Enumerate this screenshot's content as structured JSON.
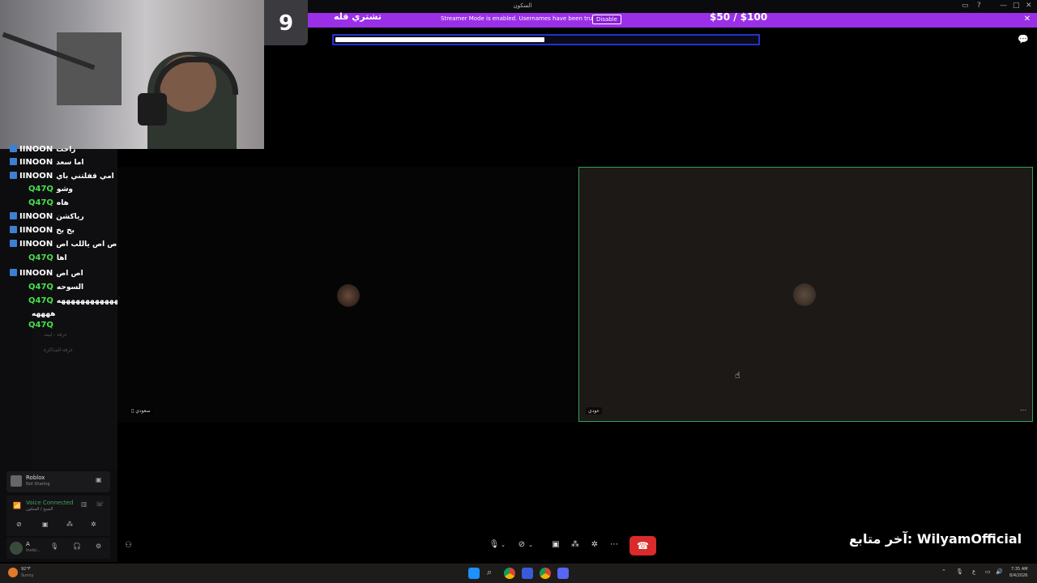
{
  "window": {
    "title": "السكون"
  },
  "banner": {
    "text": "Streamer Mode is enabled. Usernames have been truncated.",
    "disable_label": "Disable",
    "color": "#9b2fe8"
  },
  "goal": {
    "number": "9",
    "title": "تشتري قله",
    "amount": "$50 / $100",
    "progress": 0.5
  },
  "chat": [
    {
      "user": "IINOON",
      "msg": "راحت",
      "color": "#ffffff",
      "badge": true
    },
    {
      "user": "IINOON",
      "msg": "اما سعد",
      "color": "#ffffff",
      "badge": true
    },
    {
      "user": "IINOON",
      "msg": "امي قفلتني باي",
      "color": "#ffffff",
      "badge": true
    },
    {
      "user": "Q47Q",
      "msg": "وشو",
      "color": "#45e04a",
      "badge": false
    },
    {
      "user": "Q47Q",
      "msg": "هاه",
      "color": "#45e04a",
      "badge": false
    },
    {
      "user": "IINOON",
      "msg": "رياكشن",
      "color": "#ffffff",
      "badge": true
    },
    {
      "user": "IINOON",
      "msg": "بخ بخ",
      "color": "#ffffff",
      "badge": true
    },
    {
      "user": "IINOON",
      "msg": "اص اص ياللب اص",
      "color": "#ffffff",
      "badge": true
    },
    {
      "user": "Q47Q",
      "msg": "اها",
      "color": "#45e04a",
      "badge": false
    },
    {
      "user": "IINOON",
      "msg": "اص اص",
      "color": "#ffffff",
      "badge": true
    },
    {
      "user": "Q47Q",
      "msg": "السوحه",
      "color": "#45e04a",
      "badge": false
    },
    {
      "user": "Q47Q",
      "msg": "هههههههههههههههههههههه",
      "color": "#45e04a",
      "badge": false
    },
    {
      "user": "",
      "msg": "ههههه",
      "color": "#ffffff",
      "badge": false
    },
    {
      "user": "Q47Q",
      "msg": "",
      "color": "#45e04a",
      "badge": false
    }
  ],
  "channels": [
    "عرفة - ليمد",
    "غرفة-المذاكرة"
  ],
  "call": {
    "left_tile_name": "سعودي",
    "right_tile_name": "عودي",
    "active_border_color": "#2fa354"
  },
  "activity": {
    "game": "Roblox",
    "status": "Not Sharing"
  },
  "voice": {
    "status": "Voice Connected",
    "channel": "الشيخ / السكون",
    "color": "#3ba55d"
  },
  "user_panel": {
    "name": "A",
    "status": "Invisi..."
  },
  "follower": {
    "text": "آخر متابع: WilyamOfficial"
  },
  "taskbar": {
    "weather_temp": "92°F",
    "weather_desc": "Sunny",
    "time": "7:35 AM",
    "date": "8/4/2026"
  },
  "icons": [
    "windows-icon",
    "search-icon",
    "chrome-icon",
    "discord-icon",
    "microphone-icon",
    "camera-icon",
    "screen-share-icon",
    "activities-icon",
    "more-icon",
    "hangup-icon",
    "chat-icon"
  ]
}
